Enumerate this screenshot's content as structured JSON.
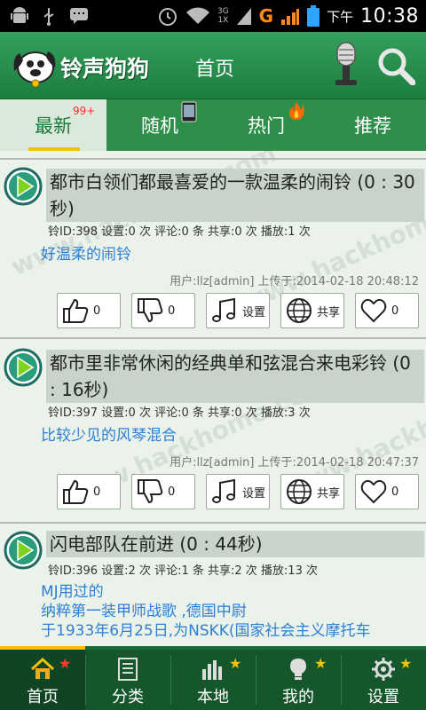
{
  "status_bar": {
    "network_label": "3G",
    "network_sub": "1X",
    "signal_g": "G",
    "ampm": "下午",
    "time": "10:38"
  },
  "app_bar": {
    "title": "铃声狗狗",
    "page": "首页"
  },
  "tabs": [
    {
      "label": "最新",
      "badge": "99+",
      "active": true
    },
    {
      "label": "随机"
    },
    {
      "label": "热门"
    },
    {
      "label": "推荐"
    }
  ],
  "items": [
    {
      "title": "都市白领们都最喜爱的一款温柔的闹铃 (0 : 30秒)",
      "meta": "铃ID:398  设置:0 次  评论:0 条  共享:0 次  播放:1 次",
      "desc": [
        "好温柔的闹铃"
      ],
      "uploader": "用户:llz[admin]  上传于:2014-02-18 20:48:12",
      "likes": "0",
      "dislikes": "0",
      "set_label": "设置",
      "share_label": "共享",
      "favorites": "0"
    },
    {
      "title": "都市里非常休闲的经典单和弦混合来电彩铃 (0 : 16秒)",
      "meta": "铃ID:397  设置:0 次  评论:0 条  共享:0 次  播放:3 次",
      "desc": [
        "比较少见的风琴混合"
      ],
      "uploader": "用户:llz[admin]  上传于:2014-02-18 20:47:37",
      "likes": "0",
      "dislikes": "0",
      "set_label": "设置",
      "share_label": "共享",
      "favorites": "0"
    },
    {
      "title": "闪电部队在前进 (0 : 44秒)",
      "meta": "铃ID:396  设置:2 次  评论:1 条  共享:2 次  播放:13 次",
      "desc": [
        "MJ用过的",
        "纳粹第一装甲师战歌 ,德国中尉",
        "于1933年6月25日,为NSKK(国家社会主义摩托车"
      ]
    }
  ],
  "bottom_nav": [
    {
      "label": "首页",
      "icon": "home-icon",
      "active": true
    },
    {
      "label": "分类",
      "icon": "list-icon"
    },
    {
      "label": "本地",
      "icon": "equalizer-icon"
    },
    {
      "label": "我的",
      "icon": "lightbulb-icon"
    },
    {
      "label": "设置",
      "icon": "gear-icon"
    }
  ],
  "watermark": "www.hackhome.com",
  "colors": {
    "header_green": "#1d7d3f",
    "tab_green": "#2e8f4b",
    "nav_green": "#16562c",
    "accent_yellow": "#f2c20a",
    "link_blue": "#2c7fd6",
    "badge_red": "#ff2a2a"
  }
}
